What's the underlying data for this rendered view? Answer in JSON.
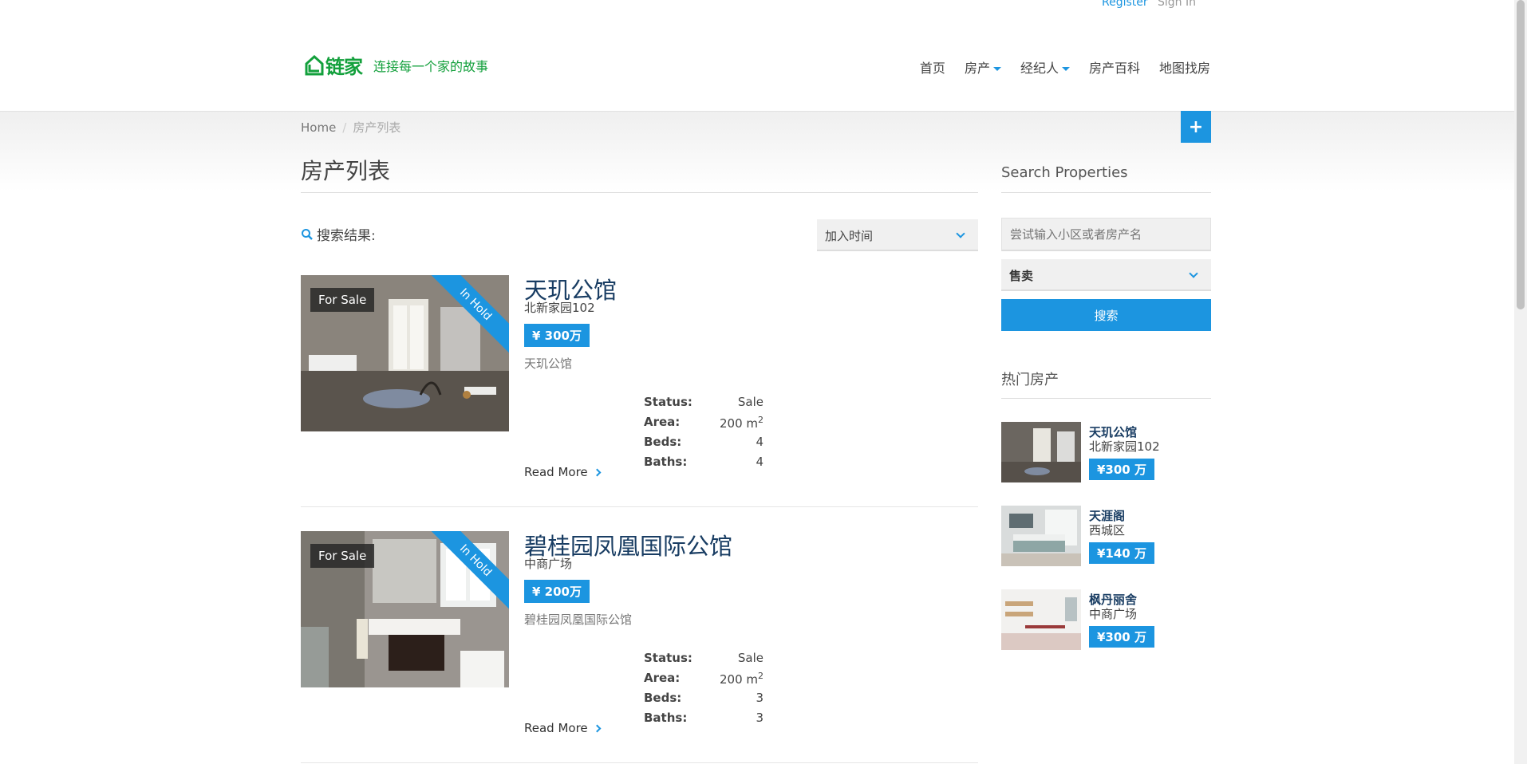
{
  "top_links": {
    "register": "Register",
    "signin": "Sign In"
  },
  "brand": {
    "name": "链家",
    "slogan": "连接每一个家的故事",
    "color": "#13a03c"
  },
  "nav": [
    {
      "label": "首页",
      "dropdown": false
    },
    {
      "label": "房产",
      "dropdown": true
    },
    {
      "label": "经纪人",
      "dropdown": true
    },
    {
      "label": "房产百科",
      "dropdown": false
    },
    {
      "label": "地图找房",
      "dropdown": false
    }
  ],
  "breadcrumb": {
    "home": "Home",
    "sep": "/",
    "current": "房产列表"
  },
  "add_button": "+",
  "page_title": "房产列表",
  "results_label": "搜索结果:",
  "sort": {
    "selected": "加入时间"
  },
  "listings": [
    {
      "title": "天玑公馆",
      "address": "北新家园102",
      "price": "¥ 300万",
      "description": "天玑公馆",
      "badge": "For Sale",
      "ribbon": "In Hold",
      "specs": {
        "status_label": "Status:",
        "status": "Sale",
        "area_label": "Area:",
        "area": "200 m",
        "area_unit_sup": "2",
        "beds_label": "Beds:",
        "beds": "4",
        "baths_label": "Baths:",
        "baths": "4"
      },
      "read_more": "Read More"
    },
    {
      "title": "碧桂园凤凰国际公馆",
      "address": "中商广场",
      "price": "¥ 200万",
      "description": "碧桂园凤凰国际公馆",
      "badge": "For Sale",
      "ribbon": "In Hold",
      "specs": {
        "status_label": "Status:",
        "status": "Sale",
        "area_label": "Area:",
        "area": "200 m",
        "area_unit_sup": "2",
        "beds_label": "Beds:",
        "beds": "3",
        "baths_label": "Baths:",
        "baths": "3"
      },
      "read_more": "Read More"
    }
  ],
  "sidebar": {
    "search_heading": "Search Properties",
    "search_placeholder": "尝试输入小区或者房产名",
    "type_selected": "售卖",
    "search_button": "搜索",
    "hot_heading": "热门房产",
    "hot": [
      {
        "name": "天玑公馆",
        "location": "北新家园102",
        "price": "¥300 万"
      },
      {
        "name": "天涯阁",
        "location": "西城区",
        "price": "¥140 万"
      },
      {
        "name": "枫丹丽舍",
        "location": "中商广场",
        "price": "¥300 万"
      }
    ]
  },
  "colors": {
    "accent": "#1c95e0",
    "title": "#193d63"
  }
}
